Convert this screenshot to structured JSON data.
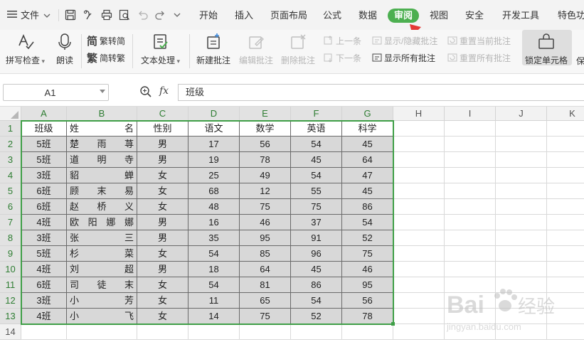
{
  "tabbar": {
    "file_menu": "文件",
    "tabs": [
      "开始",
      "插入",
      "页面布局",
      "公式",
      "数据",
      "审阅",
      "视图",
      "安全",
      "开发工具",
      "特色功"
    ],
    "active_tab": "审阅",
    "accent": "#4caf50"
  },
  "ribbon": {
    "spell_check": "拼写检查",
    "read_aloud": "朗读",
    "trad_to_simp": "繁转简",
    "simp_to_trad": "简转繁",
    "text_processing": "文本处理",
    "new_comment": "新建批注",
    "edit_comment": "编辑批注",
    "delete_comment": "删除批注",
    "prev_comment": "上一条",
    "next_comment": "下一条",
    "show_hide_comment": "显示/隐藏批注",
    "show_all_comments": "显示所有批注",
    "reset_current_comment": "重置当前批注",
    "reset_all_comments": "重置所有批注",
    "lock_cell": "锁定单元格",
    "protect": "保"
  },
  "formula_bar": {
    "cell_ref": "A1",
    "zoom_icon": "magnifier-icon",
    "fx_label": "fx",
    "content": "班级"
  },
  "sheet": {
    "columns": [
      "A",
      "B",
      "C",
      "D",
      "E",
      "F",
      "G",
      "H",
      "I",
      "J",
      "K"
    ],
    "rows": [
      "1",
      "2",
      "3",
      "4",
      "5",
      "6",
      "7",
      "8",
      "9",
      "10",
      "11",
      "12",
      "13",
      "14"
    ],
    "header": [
      "班级",
      "姓名",
      "性别",
      "语文",
      "数学",
      "英语",
      "科学"
    ],
    "data": [
      [
        "5班",
        "楚雨荨",
        "男",
        "17",
        "56",
        "54",
        "45"
      ],
      [
        "5班",
        "道明寺",
        "男",
        "19",
        "78",
        "45",
        "64"
      ],
      [
        "3班",
        "貂蝉",
        "女",
        "25",
        "49",
        "54",
        "47"
      ],
      [
        "6班",
        "顾末易",
        "女",
        "68",
        "12",
        "55",
        "45"
      ],
      [
        "6班",
        "赵桥义",
        "女",
        "48",
        "75",
        "75",
        "86"
      ],
      [
        "4班",
        "欧阳娜娜",
        "男",
        "16",
        "46",
        "37",
        "54"
      ],
      [
        "3班",
        "张三",
        "男",
        "35",
        "95",
        "91",
        "52"
      ],
      [
        "5班",
        "杉菜",
        "女",
        "54",
        "85",
        "96",
        "75"
      ],
      [
        "4班",
        "刘超",
        "男",
        "18",
        "64",
        "45",
        "46"
      ],
      [
        "6班",
        "司徒末",
        "女",
        "54",
        "81",
        "86",
        "95"
      ],
      [
        "3班",
        "小芳",
        "女",
        "11",
        "65",
        "54",
        "56"
      ],
      [
        "4班",
        "小飞",
        "女",
        "14",
        "75",
        "52",
        "78"
      ]
    ]
  },
  "watermark": {
    "brand": "Bai",
    "brand_cn": "经验",
    "url": "jingyan.baidu.com"
  }
}
